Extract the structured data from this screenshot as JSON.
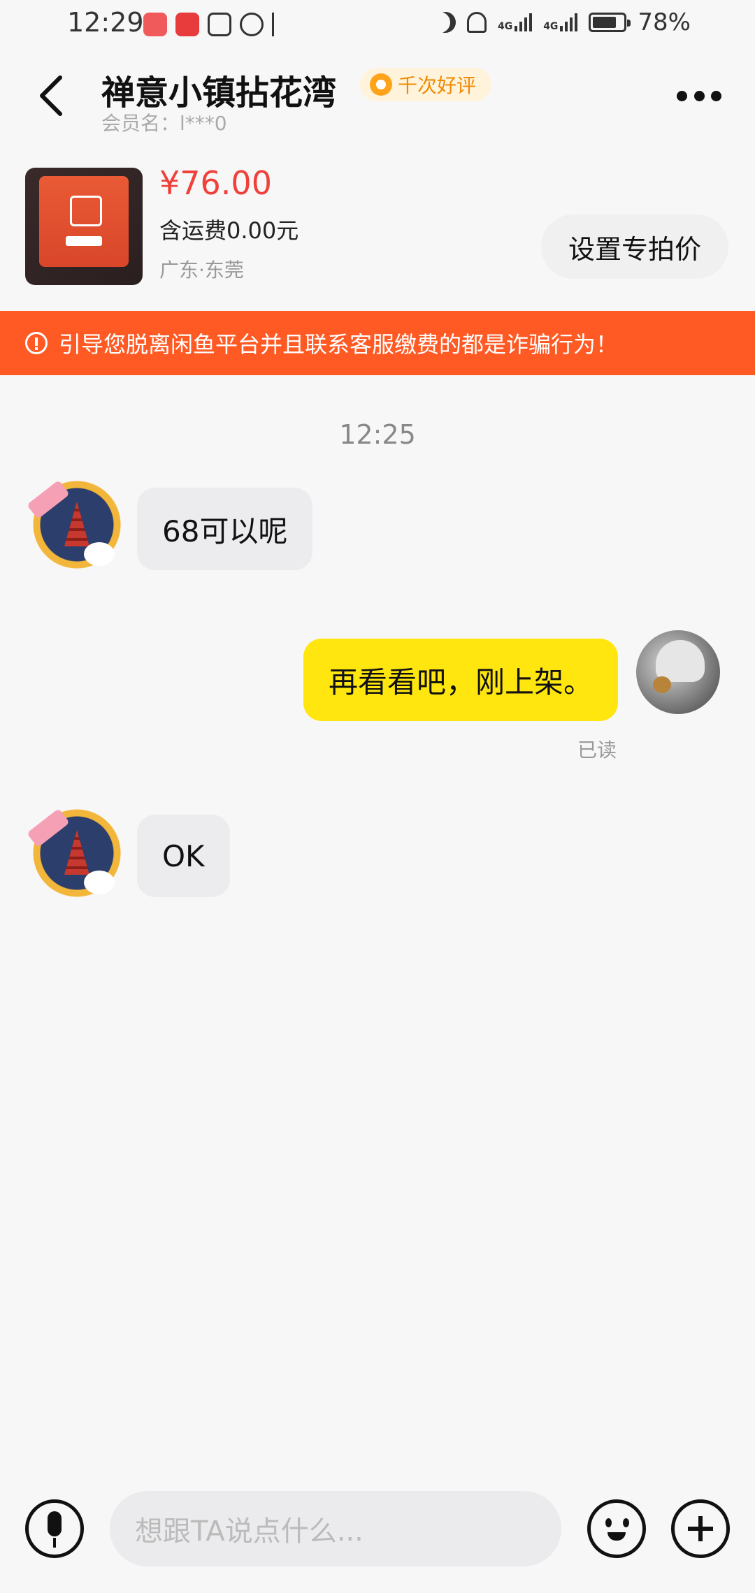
{
  "status_bar": {
    "time": "12:29",
    "net1": "4G",
    "net2": "4G",
    "battery_text": "78%",
    "battery_level": 0.78,
    "icons": [
      "huawei-app-icon",
      "game-app-icon",
      "nfc-icon",
      "alarm-icon",
      "bluetooth-icon",
      "moon-icon",
      "mute-bell-icon",
      "signal-icon",
      "signal-icon",
      "battery-icon"
    ]
  },
  "header": {
    "title": "禅意小镇拈花湾",
    "badge": "千次好评",
    "member": "会员名：l***0"
  },
  "product": {
    "price": "¥76.00",
    "shipping": "含运费0.00元",
    "location": "广东·东莞",
    "set_price_label": "设置专拍价"
  },
  "warning": {
    "text": "引导您脱离闲鱼平台并且联系客服缴费的都是诈骗行为！"
  },
  "chat": {
    "timestamp": "12:25",
    "messages": [
      {
        "from": "other",
        "text": "68可以呢"
      },
      {
        "from": "self",
        "text": "再看看吧，刚上架。",
        "status": "已读"
      },
      {
        "from": "other",
        "text": "OK"
      }
    ]
  },
  "input": {
    "placeholder": "想跟TA说点什么..."
  },
  "colors": {
    "warning_bg": "#ff5a24",
    "price": "#f0403a",
    "self_bubble": "#ffe60f",
    "other_bubble": "#ececef"
  }
}
